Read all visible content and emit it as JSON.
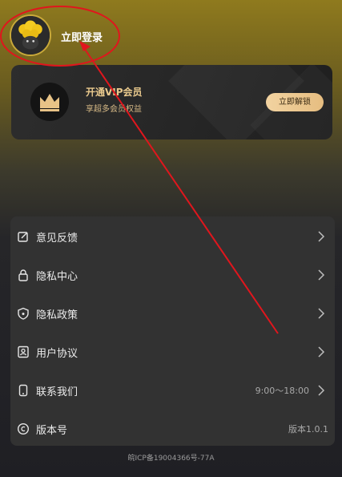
{
  "header": {
    "login_text": "立即登录"
  },
  "vip": {
    "title": "开通VIP会员",
    "subtitle": "享超多会员权益",
    "button": "立即解锁",
    "accent": "#e9c98d"
  },
  "menu": {
    "items": [
      {
        "label": "意见反馈",
        "value": "",
        "icon": "feedback-edit-icon"
      },
      {
        "label": "隐私中心",
        "value": "",
        "icon": "lock-icon"
      },
      {
        "label": "隐私政策",
        "value": "",
        "icon": "shield-icon"
      },
      {
        "label": "用户协议",
        "value": "",
        "icon": "user-agreement-icon"
      },
      {
        "label": "联系我们",
        "value": "9:00～18:00",
        "icon": "phone-contact-icon"
      },
      {
        "label": "版本号",
        "value": "版本1.0.1",
        "icon": "copyright-icon"
      }
    ]
  },
  "footer": {
    "icp": "皖ICP备19004366号-77A"
  },
  "colors": {
    "annotation_red": "#e0161d",
    "card_bg": "#323232"
  }
}
